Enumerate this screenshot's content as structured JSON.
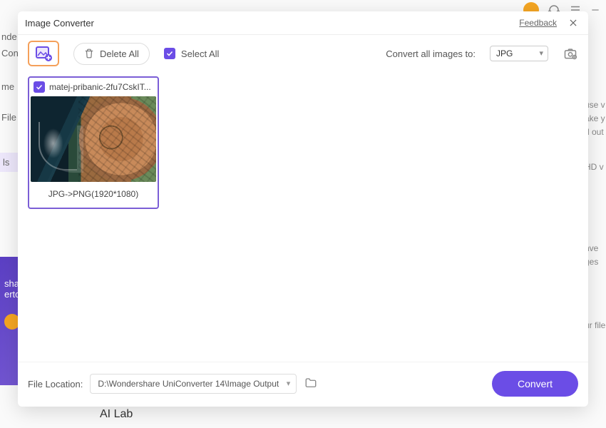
{
  "dialog": {
    "title": "Image Converter",
    "feedback": "Feedback"
  },
  "toolbar": {
    "delete_all": "Delete All",
    "select_all": "Select All",
    "convert_label": "Convert all images to:",
    "format": "JPG"
  },
  "thumbs": [
    {
      "filename": "matej-pribanic-2fu7CskIT...",
      "info": "JPG->PNG(1920*1080)",
      "checked": true
    }
  ],
  "footer": {
    "location_label": "File Location:",
    "path": "D:\\Wondershare UniConverter 14\\Image Output",
    "convert": "Convert"
  },
  "background": {
    "left_items": [
      "nde",
      "Con",
      "me",
      "File",
      "ls"
    ],
    "right_items": [
      "use v",
      "ake y",
      "d out",
      "HD v",
      "nve",
      "ges",
      "ur file"
    ],
    "promo": [
      "shar",
      "erto"
    ],
    "ai_lab": "AI Lab"
  }
}
